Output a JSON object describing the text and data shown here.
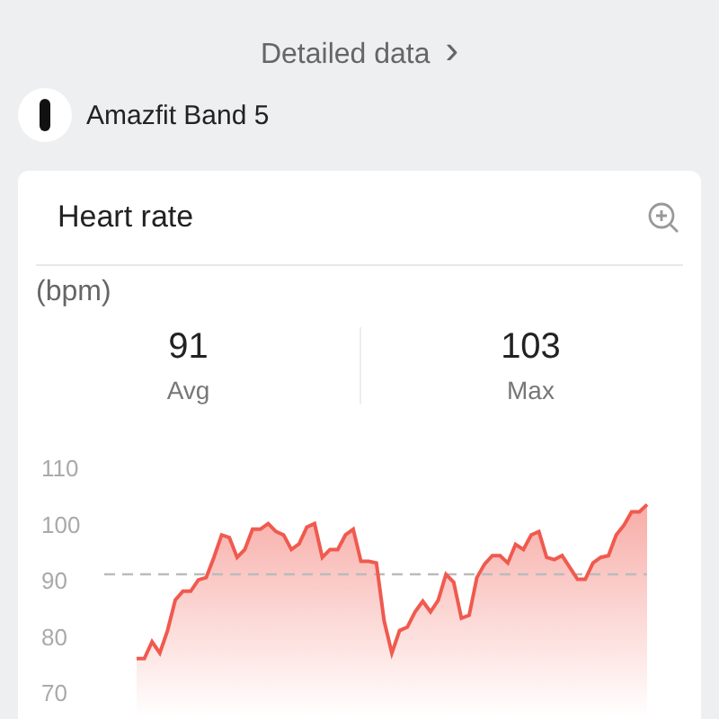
{
  "detail_link": {
    "label": "Detailed data",
    "chevron": "›"
  },
  "device": {
    "name": "Amazfit Band 5"
  },
  "card": {
    "title": "Heart rate",
    "unit": "(bpm)",
    "stats": [
      {
        "value": "91",
        "label": "Avg"
      },
      {
        "value": "103",
        "label": "Max"
      }
    ],
    "chart_data": {
      "type": "area",
      "ylim": [
        70,
        110
      ],
      "yticks": [
        70,
        80,
        90,
        100,
        110
      ],
      "series": [
        {
          "color": "#f05a4f",
          "values": [
            76,
            76,
            79,
            77,
            81,
            86.4,
            88,
            88,
            90,
            90.4,
            94,
            98,
            97.5,
            94,
            95.4,
            99,
            99,
            100,
            98.6,
            98,
            95.4,
            96.4,
            99.4,
            100,
            94,
            95.4,
            95.4,
            98,
            99,
            93.3,
            93.3,
            93,
            82.7,
            77,
            81,
            81.6,
            84.3,
            86.2,
            84.3,
            86.4,
            91,
            89.6,
            83.2,
            83.7,
            90.4,
            92.8,
            94.3,
            94.3,
            93,
            96.3,
            95.4,
            98,
            98.6,
            94,
            93.6,
            94.3,
            92.2,
            90.1,
            90.1,
            93,
            94,
            94.3,
            98,
            99.7,
            102.1,
            102.1,
            103.4
          ]
        }
      ]
    }
  }
}
